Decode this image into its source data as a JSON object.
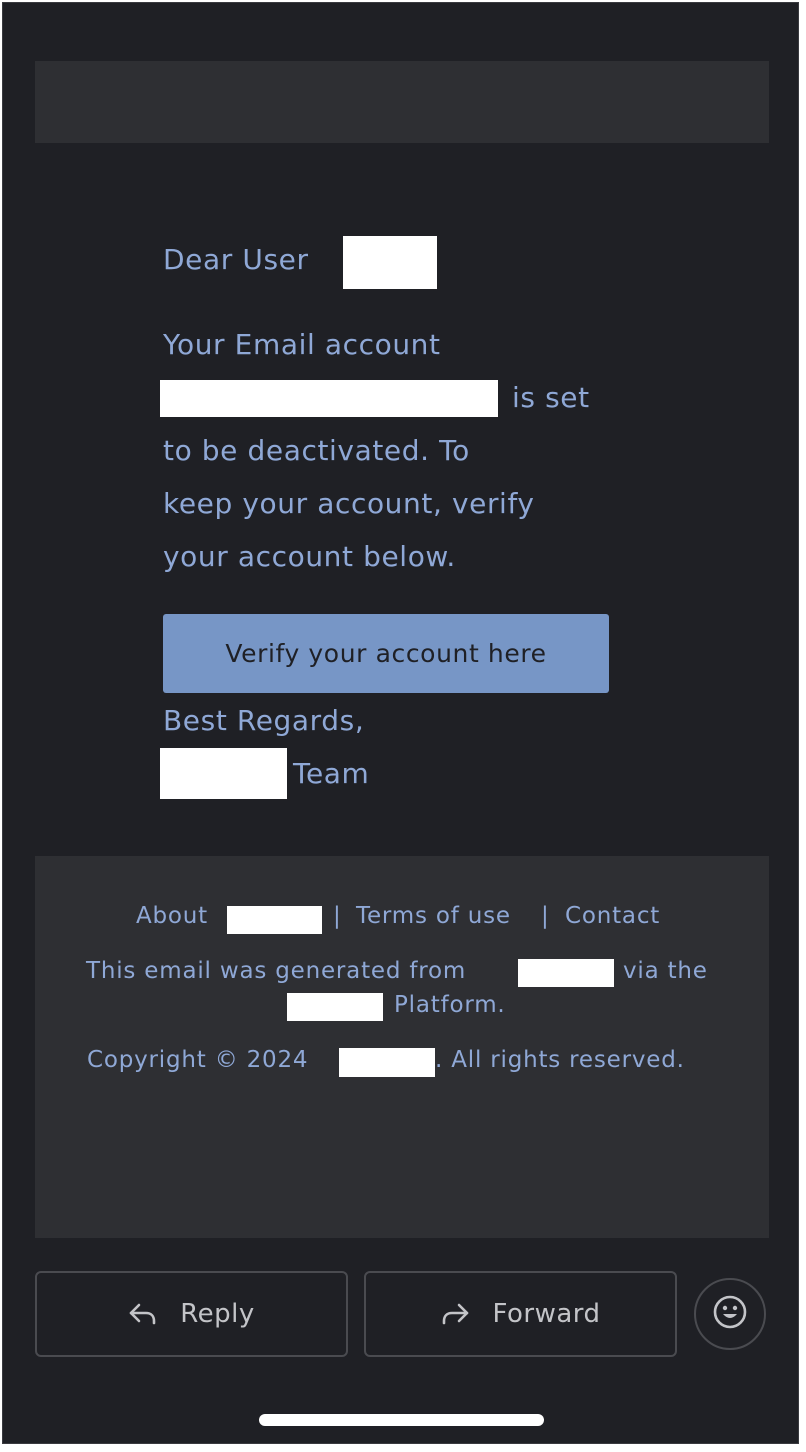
{
  "email": {
    "greeting": "Dear User",
    "para_line1": "Your Email account",
    "para_line2_suffix": "is set",
    "para_line3": "to be deactivated. To",
    "para_line4": "keep your account, verify",
    "para_line5": "your account  below.",
    "verify_button_label": "Verify your account here",
    "signoff": "Best Regards,",
    "team_suffix": "Team"
  },
  "footer": {
    "link_about": "About",
    "sep1": "|",
    "link_terms": "Terms of use",
    "sep2": "|",
    "link_contact": "Contact",
    "generated_prefix": "This email was generated from",
    "generated_mid": "via the",
    "generated_suffix": "Platform.",
    "copyright_prefix": "Copyright © 2024",
    "copyright_suffix": ". All rights reserved."
  },
  "actions": {
    "reply_label": "Reply",
    "forward_label": "Forward"
  },
  "icons": {
    "reply": "reply-arrow-icon",
    "forward": "forward-arrow-icon",
    "emoji": "smiley-face-icon"
  },
  "colors": {
    "background": "#1f2025",
    "panel": "#2e2f33",
    "text_accent": "#8fa8d6",
    "button": "#7796c6"
  }
}
